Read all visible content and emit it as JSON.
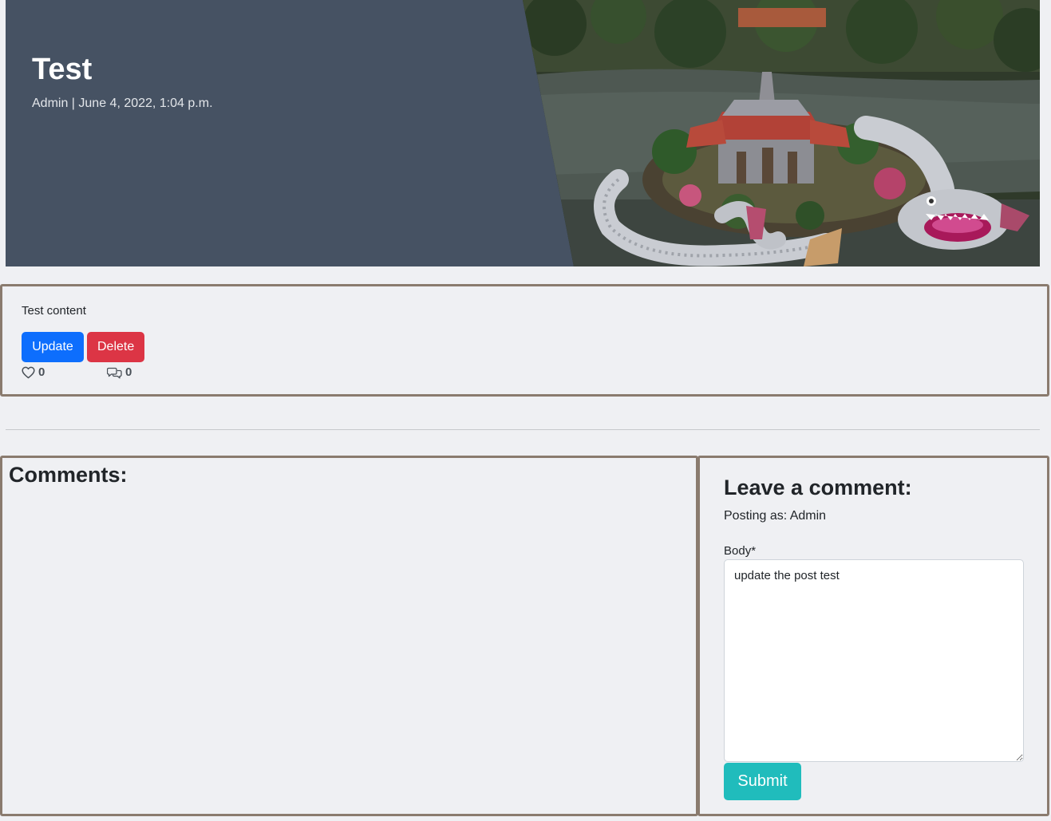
{
  "post": {
    "title": "Test",
    "meta": "Admin | June 4, 2022, 1:04 p.m.",
    "content": "Test content",
    "update_label": "Update",
    "delete_label": "Delete",
    "likes_count": "0",
    "comments_count": "0"
  },
  "comments": {
    "title": "Comments:"
  },
  "comment_form": {
    "title": "Leave a comment:",
    "posting_as": "Posting as: Admin",
    "body_label": "Body*",
    "body_value": "update the post test",
    "submit_label": "Submit"
  },
  "colors": {
    "hero_bg": "#465263",
    "panel_border": "#8a7b6e",
    "update_button": "#0d6efd",
    "delete_button": "#dc3545",
    "submit_button": "#20bcbc",
    "page_bg": "#eff0f3"
  },
  "icons": {
    "like": "heart-outline-icon",
    "comment": "chat-bubbles-icon"
  }
}
